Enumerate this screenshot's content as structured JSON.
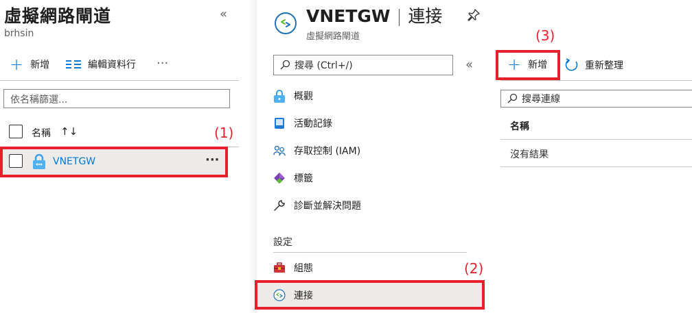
{
  "left_pane": {
    "title": "虛擬網路閘道",
    "subtitle": "brhsin",
    "collapse_glyph": "«",
    "toolbar": {
      "add_label": "新增",
      "edit_columns_label": "編輯資料行",
      "more_glyph": "···"
    },
    "filter": {
      "placeholder": "依名稱篩選..."
    },
    "table": {
      "header_name": "名稱",
      "sort_glyph": "↑↓",
      "rows": [
        {
          "name": "VNETGW",
          "more_glyph": "···"
        }
      ]
    }
  },
  "resource": {
    "title": "VNETGW",
    "separator": "|",
    "page": "連接",
    "subtitle": "虛擬網路閘道"
  },
  "menu": {
    "search_placeholder": "搜尋 (Ctrl+/)",
    "collapse_glyph": "«",
    "items": [
      {
        "label": "概觀",
        "icon": "overview-icon"
      },
      {
        "label": "活動記錄",
        "icon": "activity-log-icon"
      },
      {
        "label": "存取控制 (IAM)",
        "icon": "iam-icon"
      },
      {
        "label": "標籤",
        "icon": "tag-icon"
      },
      {
        "label": "診斷並解決問題",
        "icon": "wrench-icon"
      }
    ],
    "settings_section": "設定",
    "settings_items": [
      {
        "label": "組態",
        "icon": "toolbox-icon"
      },
      {
        "label": "連接",
        "icon": "connection-icon"
      }
    ]
  },
  "content": {
    "add_label": "新增",
    "refresh_label": "重新整理",
    "search_placeholder": "搜尋連線",
    "column_name": "名稱",
    "empty_text": "沒有結果"
  },
  "annotations": {
    "label_1": "(1)",
    "label_2": "(2)",
    "label_3": "(3)",
    "color": "#e8202b"
  },
  "colors": {
    "accent": "#0078d4",
    "selected_row_bg": "#edebe9"
  }
}
